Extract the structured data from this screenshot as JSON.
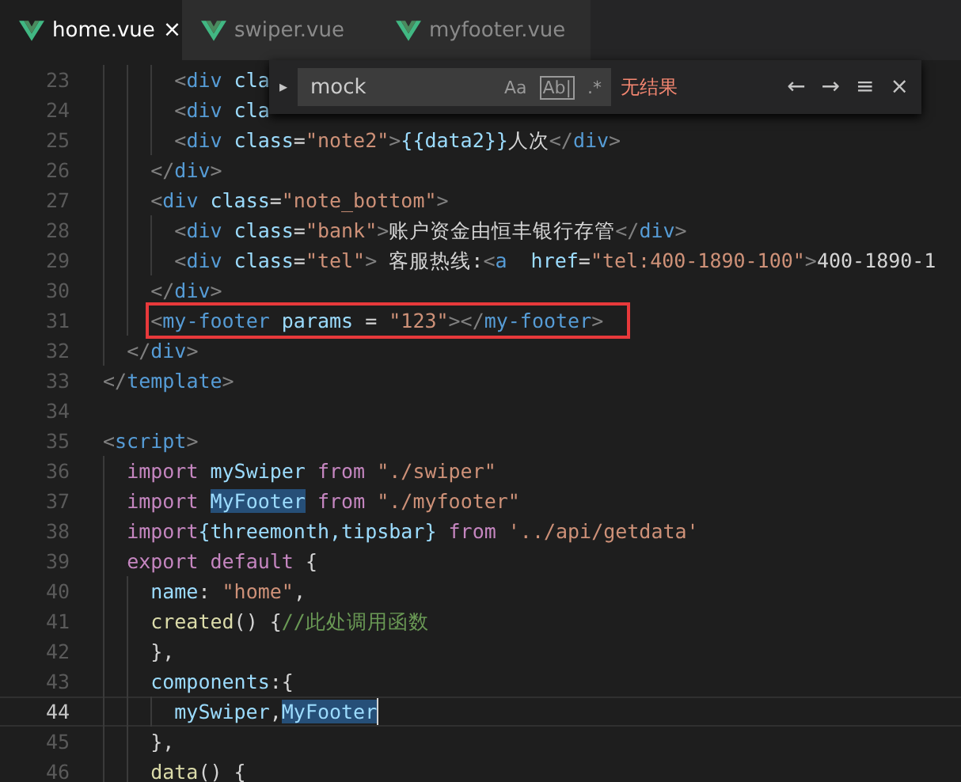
{
  "tabs": [
    {
      "label": "home.vue",
      "selected": true,
      "close": "×"
    },
    {
      "label": "swiper.vue",
      "selected": false
    },
    {
      "label": "myfooter.vue",
      "selected": false
    }
  ],
  "find": {
    "toggle": "▸",
    "value": "mock",
    "options": [
      "Aa",
      "Ab|",
      ".*"
    ],
    "result": "无结果",
    "actions": [
      "←",
      "→",
      "≡",
      "×"
    ]
  },
  "lines": [
    {
      "number": "23",
      "current": false,
      "boxed": false,
      "tokens": [
        {
          "text": "      <",
          "kind": "punct"
        },
        {
          "text": "div",
          "kind": "tag"
        },
        {
          "text": " cla",
          "kind": "attr"
        }
      ]
    },
    {
      "number": "24",
      "current": false,
      "boxed": false,
      "tokens": [
        {
          "text": "      <",
          "kind": "punct"
        },
        {
          "text": "div",
          "kind": "tag"
        },
        {
          "text": " cla",
          "kind": "attr"
        }
      ]
    },
    {
      "number": "25",
      "current": false,
      "boxed": false,
      "tokens": [
        {
          "text": "      <",
          "kind": "punct"
        },
        {
          "text": "div",
          "kind": "tag"
        },
        {
          "text": " class",
          "kind": "attr"
        },
        {
          "text": "=",
          "kind": "text"
        },
        {
          "text": "\"note2\"",
          "kind": "str"
        },
        {
          "text": ">",
          "kind": "punct"
        },
        {
          "text": "{{data2}}",
          "kind": "id"
        },
        {
          "text": "人次",
          "kind": "text"
        },
        {
          "text": "</",
          "kind": "punct"
        },
        {
          "text": "div",
          "kind": "tag"
        },
        {
          "text": ">",
          "kind": "punct"
        }
      ]
    },
    {
      "number": "26",
      "current": false,
      "boxed": false,
      "tokens": [
        {
          "text": "    </",
          "kind": "punct"
        },
        {
          "text": "div",
          "kind": "tag"
        },
        {
          "text": ">",
          "kind": "punct"
        }
      ]
    },
    {
      "number": "27",
      "current": false,
      "boxed": false,
      "tokens": [
        {
          "text": "    <",
          "kind": "punct"
        },
        {
          "text": "div",
          "kind": "tag"
        },
        {
          "text": " class",
          "kind": "attr"
        },
        {
          "text": "=",
          "kind": "text"
        },
        {
          "text": "\"note_bottom\"",
          "kind": "str"
        },
        {
          "text": ">",
          "kind": "punct"
        }
      ]
    },
    {
      "number": "28",
      "current": false,
      "boxed": false,
      "tokens": [
        {
          "text": "      <",
          "kind": "punct"
        },
        {
          "text": "div",
          "kind": "tag"
        },
        {
          "text": " class",
          "kind": "attr"
        },
        {
          "text": "=",
          "kind": "text"
        },
        {
          "text": "\"bank\"",
          "kind": "str"
        },
        {
          "text": ">",
          "kind": "punct"
        },
        {
          "text": "账户资金由恒丰银行存管",
          "kind": "text"
        },
        {
          "text": "</",
          "kind": "punct"
        },
        {
          "text": "div",
          "kind": "tag"
        },
        {
          "text": ">",
          "kind": "punct"
        }
      ]
    },
    {
      "number": "29",
      "current": false,
      "boxed": false,
      "tokens": [
        {
          "text": "      <",
          "kind": "punct"
        },
        {
          "text": "div",
          "kind": "tag"
        },
        {
          "text": " class",
          "kind": "attr"
        },
        {
          "text": "=",
          "kind": "text"
        },
        {
          "text": "\"tel\"",
          "kind": "str"
        },
        {
          "text": ">",
          "kind": "punct"
        },
        {
          "text": " 客服热线:",
          "kind": "text"
        },
        {
          "text": "<",
          "kind": "punct"
        },
        {
          "text": "a",
          "kind": "tag"
        },
        {
          "text": "  href",
          "kind": "attr"
        },
        {
          "text": "=",
          "kind": "text"
        },
        {
          "text": "\"tel:400-1890-100\"",
          "kind": "str"
        },
        {
          "text": ">",
          "kind": "punct"
        },
        {
          "text": "400-1890-1",
          "kind": "text"
        }
      ]
    },
    {
      "number": "30",
      "current": false,
      "boxed": false,
      "tokens": [
        {
          "text": "    </",
          "kind": "punct"
        },
        {
          "text": "div",
          "kind": "tag"
        },
        {
          "text": ">",
          "kind": "punct"
        }
      ]
    },
    {
      "number": "31",
      "current": false,
      "boxed": true,
      "tokens": [
        {
          "text": "    <",
          "kind": "punct"
        },
        {
          "text": "my-footer",
          "kind": "tag"
        },
        {
          "text": " params",
          "kind": "attr"
        },
        {
          "text": " = ",
          "kind": "text"
        },
        {
          "text": "\"123\"",
          "kind": "str"
        },
        {
          "text": "></",
          "kind": "punct"
        },
        {
          "text": "my-footer",
          "kind": "tag"
        },
        {
          "text": ">",
          "kind": "punct"
        }
      ]
    },
    {
      "number": "32",
      "current": false,
      "boxed": false,
      "tokens": [
        {
          "text": "  </",
          "kind": "punct"
        },
        {
          "text": "div",
          "kind": "tag"
        },
        {
          "text": ">",
          "kind": "punct"
        }
      ]
    },
    {
      "number": "33",
      "current": false,
      "boxed": false,
      "tokens": [
        {
          "text": "</",
          "kind": "punct"
        },
        {
          "text": "template",
          "kind": "tag"
        },
        {
          "text": ">",
          "kind": "punct"
        }
      ]
    },
    {
      "number": "34",
      "current": false
    },
    {
      "number": "35",
      "current": false,
      "boxed": false,
      "tokens": [
        {
          "text": "<",
          "kind": "punct"
        },
        {
          "text": "script",
          "kind": "tag"
        },
        {
          "text": ">",
          "kind": "punct"
        }
      ]
    },
    {
      "number": "36",
      "current": false,
      "boxed": false,
      "tokens": [
        {
          "text": "  import",
          "kind": "kw"
        },
        {
          "text": " mySwiper ",
          "kind": "id"
        },
        {
          "text": "from",
          "kind": "kw"
        },
        {
          "text": " \"./swiper\"",
          "kind": "str"
        }
      ]
    },
    {
      "number": "37",
      "current": false,
      "boxed": false,
      "tokens": [
        {
          "text": "  import ",
          "kind": "kw"
        },
        {
          "text": "MyFooter",
          "kind": "id",
          "highlight": true
        },
        {
          "text": " from",
          "kind": "kw"
        },
        {
          "text": " \"./myfooter\"",
          "kind": "str"
        }
      ]
    },
    {
      "number": "38",
      "current": false,
      "boxed": false,
      "tokens": [
        {
          "text": "  import",
          "kind": "kw"
        },
        {
          "text": "{threemonth,tipsbar} ",
          "kind": "id"
        },
        {
          "text": "from",
          "kind": "kw"
        },
        {
          "text": " '../api/getdata'",
          "kind": "str"
        }
      ]
    },
    {
      "number": "39",
      "current": false,
      "boxed": false,
      "tokens": [
        {
          "text": "  export default",
          "kind": "kw"
        },
        {
          "text": " {",
          "kind": "text"
        }
      ]
    },
    {
      "number": "40",
      "current": false,
      "boxed": false,
      "tokens": [
        {
          "text": "    name",
          "kind": "id"
        },
        {
          "text": ": ",
          "kind": "text"
        },
        {
          "text": "\"home\"",
          "kind": "str"
        },
        {
          "text": ",",
          "kind": "text"
        }
      ]
    },
    {
      "number": "41",
      "current": false,
      "boxed": false,
      "tokens": [
        {
          "text": "    created",
          "kind": "fn"
        },
        {
          "text": "() {",
          "kind": "text"
        },
        {
          "text": "//此处调用函数",
          "kind": "cmt"
        }
      ]
    },
    {
      "number": "42",
      "current": false,
      "boxed": false,
      "tokens": [
        {
          "text": "    },",
          "kind": "text"
        }
      ]
    },
    {
      "number": "43",
      "current": false,
      "boxed": false,
      "tokens": [
        {
          "text": "    components",
          "kind": "id"
        },
        {
          "text": ":{",
          "kind": "text"
        }
      ]
    },
    {
      "number": "44",
      "current": true,
      "boxed": false,
      "tokens": [
        {
          "text": "      mySwiper",
          "kind": "id"
        },
        {
          "text": ",",
          "kind": "text"
        },
        {
          "text": "MyFooter",
          "kind": "id",
          "highlight": true
        }
      ]
    },
    {
      "number": "45",
      "current": false,
      "boxed": false,
      "tokens": [
        {
          "text": "    },",
          "kind": "text"
        }
      ]
    },
    {
      "number": "46",
      "current": false,
      "boxed": false,
      "tokens": [
        {
          "text": "    data",
          "kind": "fn"
        },
        {
          "text": "() {",
          "kind": "text"
        }
      ]
    }
  ]
}
